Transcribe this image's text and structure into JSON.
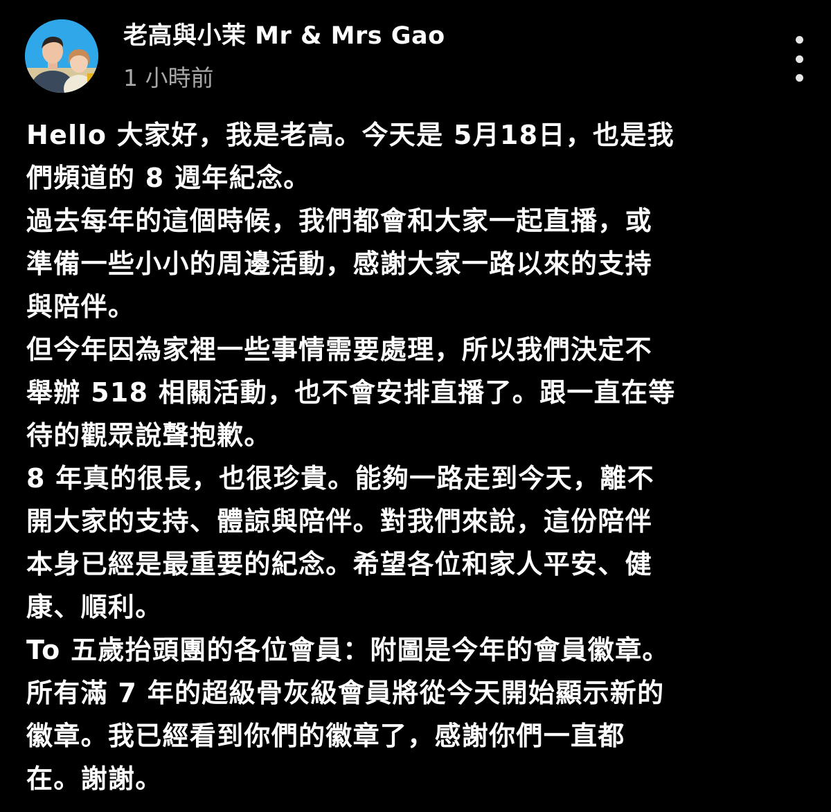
{
  "post": {
    "channel_name": "老高與小茉 Mr & Mrs Gao",
    "timestamp": "1 小時前",
    "avatar": "channel-avatar-photo",
    "menu_icon": "more-vertical-icon",
    "paragraphs": [
      "Hello 大家好，我是老高。今天是 5月18日，也是我\n們頻道的 8 週年紀念。",
      "過去每年的這個時候，我們都會和大家一起直播，或\n準備一些小小的周邊活動，感謝大家一路以來的支持\n與陪伴。",
      "但今年因為家裡一些事情需要處理，所以我們決定不\n舉辦 518 相關活動，也不會安排直播了。跟一直在等\n待的觀眾說聲抱歉。",
      "8 年真的很長，也很珍貴。能夠一路走到今天，離不\n開大家的支持、體諒與陪伴。對我們來說，這份陪伴\n本身已經是最重要的紀念。希望各位和家人平安、健\n康、順利。",
      "To 五歲抬頭團的各位會員：附圖是今年的會員徽章。\n所有滿 7 年的超級骨灰級會員將從今天開始顯示新的\n徽章。我已經看到你們的徽章了，感謝你們一直都\n在。謝謝。"
    ]
  },
  "colors": {
    "background": "#000000",
    "text": "#ffffff",
    "timestamp": "#a8a8a8",
    "avatar_background": "#2fa7e8"
  }
}
